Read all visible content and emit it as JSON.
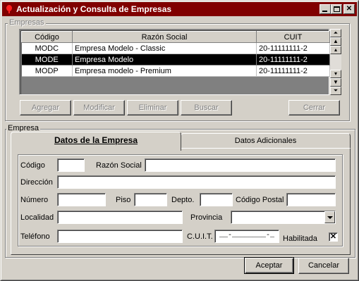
{
  "window": {
    "title": "Actualización y Consulta de Empresas",
    "titlebar_color": "#800000",
    "icon": "red-drop-icon"
  },
  "empresas_group": {
    "label": "Empresas",
    "columns": [
      "Código",
      "Razón Social",
      "CUIT"
    ],
    "rows": [
      {
        "codigo": "MODC",
        "razon_social": "Empresa Modelo - Classic",
        "cuit": "20-11111111-2",
        "selected": false
      },
      {
        "codigo": "MODE",
        "razon_social": "Empresa Modelo",
        "cuit": "20-11111111-2",
        "selected": true
      },
      {
        "codigo": "MODP",
        "razon_social": "Empresa modelo - Premium",
        "cuit": "20-11111111-2",
        "selected": false
      }
    ],
    "buttons": {
      "agregar": "Agregar",
      "modificar": "Modificar",
      "eliminar": "Eliminar",
      "buscar": "Buscar",
      "cerrar": "Cerrar"
    }
  },
  "empresa_group": {
    "label": "Empresa",
    "tabs": [
      "Datos de la Empresa",
      "Datos Adicionales"
    ],
    "fields": {
      "codigo_label": "Código",
      "razon_social_label": "Razón Social",
      "direccion_label": "Dirección",
      "numero_label": "Número",
      "piso_label": "Piso",
      "depto_label": "Depto.",
      "codigo_postal_label": "Código Postal",
      "localidad_label": "Localidad",
      "provincia_label": "Provincia",
      "telefono_label": "Teléfono",
      "cuit_label": "C.U.I.T.",
      "cuit_mask": "__-________-_",
      "habilitada_label": "Habilitada",
      "habilitada_checked": "✕"
    }
  },
  "footer": {
    "aceptar": "Aceptar",
    "cancelar": "Cancelar"
  }
}
